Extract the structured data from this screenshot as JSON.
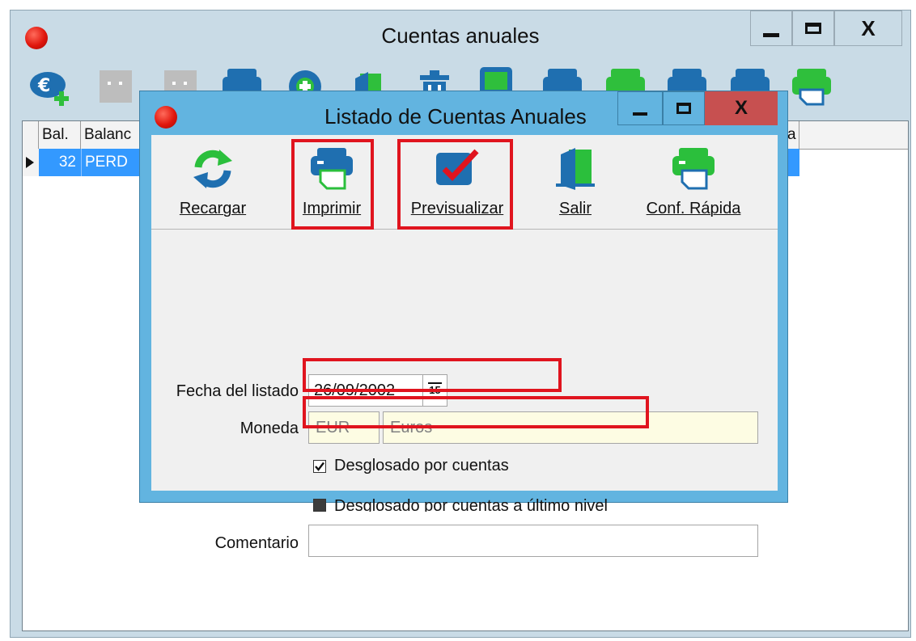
{
  "main_window": {
    "title": "Cuentas anuales",
    "controls": [
      "minimize",
      "maximize",
      "close"
    ],
    "close_glyph": "X",
    "toolbar_icons": [
      "add-euro-icon",
      "disabled-icon",
      "disabled-icon",
      "printer-icon",
      "plus-circle-icon",
      "door-icon",
      "trash-icon",
      "monitor-icon",
      "printer-icon",
      "printer-icon",
      "printer-icon",
      "printer-icon",
      "printer-quick-icon"
    ],
    "grid": {
      "columns": [
        "Bal.",
        "Balanc"
      ],
      "rows": [
        {
          "bal": "32",
          "balance": "PERD"
        }
      ],
      "right_fragment": "a"
    }
  },
  "dialog": {
    "title": "Listado de Cuentas Anuales",
    "close_glyph": "X",
    "toolbar": [
      {
        "id": "recargar",
        "label": "Recargar",
        "icon": "refresh-icon"
      },
      {
        "id": "imprimir",
        "label": "Imprimir",
        "icon": "printer-icon"
      },
      {
        "id": "previsualizar",
        "label": "Previsualizar",
        "icon": "preview-check-icon"
      },
      {
        "id": "salir",
        "label": "Salir",
        "icon": "exit-door-icon"
      },
      {
        "id": "conf_rapida",
        "label": "Conf. Rápida",
        "icon": "printer-settings-icon"
      }
    ],
    "form": {
      "fecha_label": "Fecha del listado",
      "fecha_value": "26/09/2002",
      "calendar_glyph": "15",
      "moneda_label": "Moneda",
      "moneda_code": "EUR",
      "moneda_name": "Euros",
      "check1_label": "Desglosado por cuentas",
      "check1_checked": true,
      "check2_label": "Desglosado por cuentas a último nivel",
      "check2_checked": true,
      "comentario_label": "Comentario",
      "comentario_value": ""
    }
  },
  "colors": {
    "highlight": "#e0141e",
    "dialog_frame": "#62b4e0",
    "selection": "#3399ff",
    "close_button": "#c75050",
    "readonly_field": "#fdfce3"
  }
}
